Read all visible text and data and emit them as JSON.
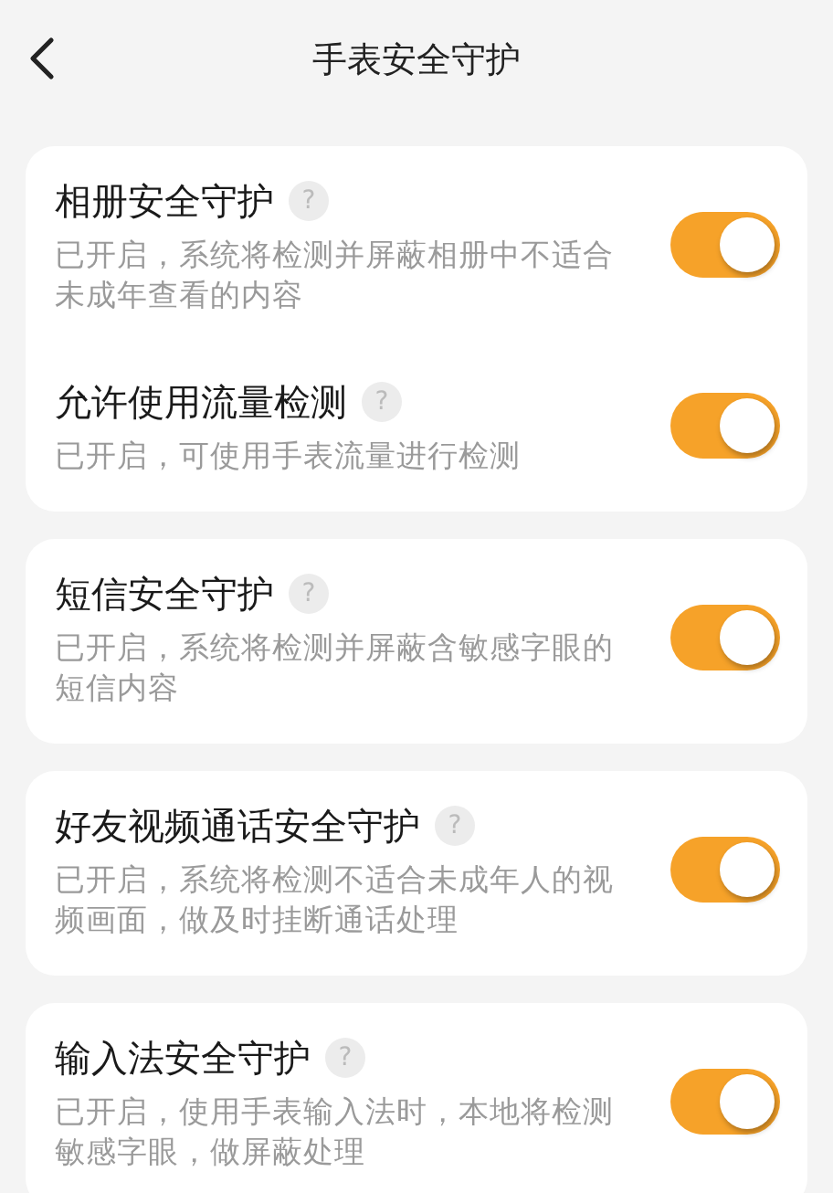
{
  "header": {
    "title": "手表安全守护"
  },
  "groups": [
    {
      "items": [
        {
          "title": "相册安全守护",
          "help": "?",
          "description": "已开启，系统将检测并屏蔽相册中不适合未成年查看的内容",
          "on": true
        },
        {
          "title": "允许使用流量检测",
          "help": "?",
          "description": "已开启，可使用手表流量进行检测",
          "on": true
        }
      ]
    },
    {
      "items": [
        {
          "title": "短信安全守护",
          "help": "?",
          "description": "已开启，系统将检测并屏蔽含敏感字眼的短信内容",
          "on": true
        }
      ]
    },
    {
      "items": [
        {
          "title": "好友视频通话安全守护",
          "help": "?",
          "description": "已开启，系统将检测不适合未成年人的视频画面，做及时挂断通话处理",
          "on": true
        }
      ]
    },
    {
      "items": [
        {
          "title": "输入法安全守护",
          "help": "?",
          "description": "已开启，使用手表输入法时，本地将检测敏感字眼，做屏蔽处理",
          "on": true
        }
      ]
    }
  ]
}
